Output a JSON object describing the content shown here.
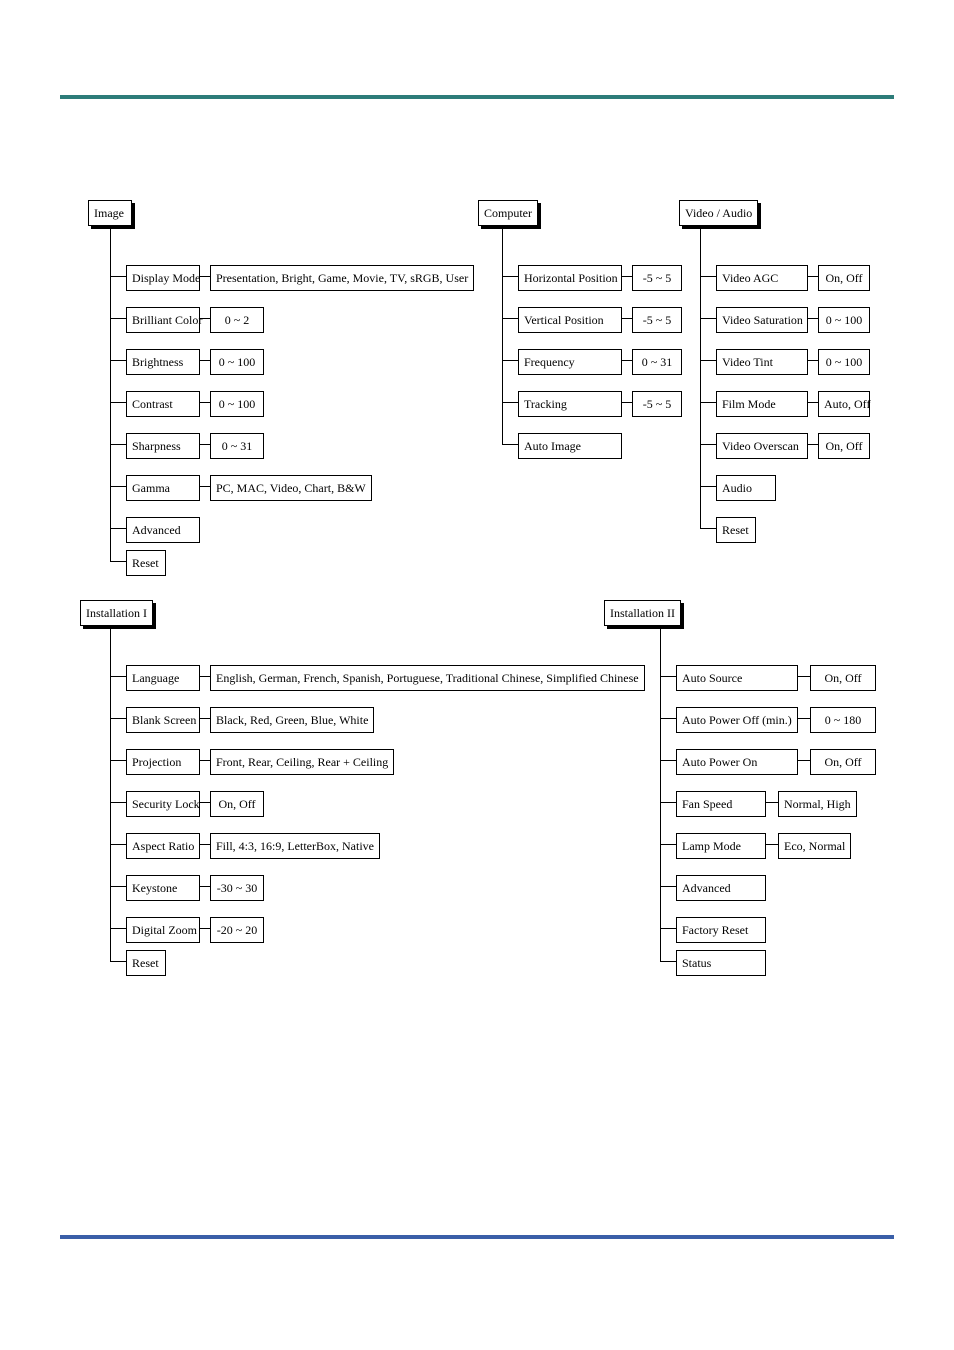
{
  "menus": {
    "image": {
      "title": "Image",
      "items": [
        {
          "label": "Display Mode",
          "value": "Presentation, Bright, Game, Movie, TV, sRGB, User"
        },
        {
          "label": "Brilliant Color",
          "value": "0 ~ 2"
        },
        {
          "label": "Brightness",
          "value": "0 ~ 100"
        },
        {
          "label": "Contrast",
          "value": "0 ~ 100"
        },
        {
          "label": "Sharpness",
          "value": "0 ~ 31"
        },
        {
          "label": "Gamma",
          "value": "PC, MAC, Video, Chart, B&W"
        },
        {
          "label": "Advanced"
        },
        {
          "label": "Reset"
        }
      ]
    },
    "computer": {
      "title": "Computer",
      "items": [
        {
          "label": "Horizontal Position",
          "value": "-5 ~ 5"
        },
        {
          "label": "Vertical Position",
          "value": "-5 ~ 5"
        },
        {
          "label": "Frequency",
          "value": "0 ~ 31"
        },
        {
          "label": "Tracking",
          "value": "-5 ~ 5"
        },
        {
          "label": "Auto Image"
        }
      ]
    },
    "video_audio": {
      "title": "Video / Audio",
      "items": [
        {
          "label": "Video AGC",
          "value": "On, Off"
        },
        {
          "label": "Video Saturation",
          "value": "0 ~ 100"
        },
        {
          "label": "Video Tint",
          "value": "0 ~ 100"
        },
        {
          "label": "Film Mode",
          "value": "Auto, Off"
        },
        {
          "label": "Video Overscan",
          "value": "On, Off"
        },
        {
          "label": "Audio"
        },
        {
          "label": "Reset"
        }
      ]
    },
    "installation1": {
      "title": "Installation I",
      "items": [
        {
          "label": "Language",
          "value": "English, German, French, Spanish, Portuguese, Traditional Chinese, Simplified Chinese"
        },
        {
          "label": "Blank Screen",
          "value": "Black, Red, Green, Blue, White"
        },
        {
          "label": "Projection",
          "value": "Front, Rear, Ceiling, Rear + Ceiling"
        },
        {
          "label": "Security Lock",
          "value": "On, Off"
        },
        {
          "label": "Aspect Ratio",
          "value": "Fill, 4:3, 16:9, LetterBox, Native"
        },
        {
          "label": "Keystone",
          "value": "-30 ~ 30"
        },
        {
          "label": "Digital Zoom",
          "value": "-20 ~ 20"
        },
        {
          "label": "Reset"
        }
      ]
    },
    "installation2": {
      "title": "Installation II",
      "items": [
        {
          "label": "Auto Source",
          "value": "On, Off"
        },
        {
          "label": "Auto Power Off (min.)",
          "value": "0 ~ 180"
        },
        {
          "label": "Auto Power On",
          "value": "On, Off"
        },
        {
          "label": "Fan Speed",
          "value": "Normal, High"
        },
        {
          "label": "Lamp Mode",
          "value": "Eco, Normal"
        },
        {
          "label": "Advanced"
        },
        {
          "label": "Factory Reset"
        },
        {
          "label": "Status"
        }
      ]
    }
  }
}
